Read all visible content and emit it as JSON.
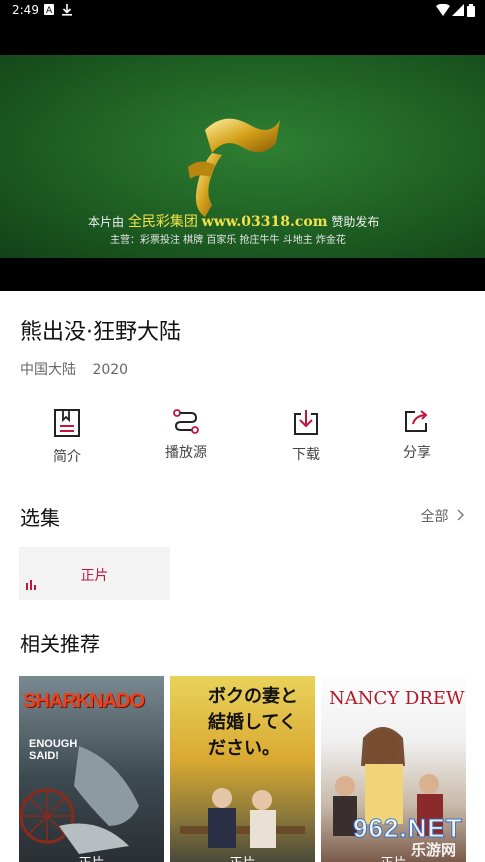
{
  "status_bar": {
    "time": "2:49"
  },
  "video": {
    "sponsor_prefix": "本片由",
    "sponsor_name": "全民彩集团",
    "sponsor_url": "www.03318.com",
    "sponsor_suffix": "赞助发布",
    "sponsor_line2": "主营：彩票投注  棋牌  百家乐  抢庄牛牛  斗地主  炸金花"
  },
  "title": "熊出没·狂野大陆",
  "meta": {
    "region": "中国大陆",
    "year": "2020"
  },
  "actions": [
    {
      "label": "简介",
      "icon": "document-icon"
    },
    {
      "label": "播放源",
      "icon": "route-icon"
    },
    {
      "label": "下载",
      "icon": "download-icon"
    },
    {
      "label": "分享",
      "icon": "share-icon"
    }
  ],
  "episodes": {
    "heading": "选集",
    "all_label": "全部",
    "items": [
      {
        "label": "正片"
      }
    ]
  },
  "recommend": {
    "heading": "相关推荐",
    "items": [
      {
        "poster_title": "SHARKNADO",
        "poster_tagline": "ENOUGH SAID!",
        "caption": "正片"
      },
      {
        "poster_title": "ボクの妻と結婚してください。",
        "caption": "正片"
      },
      {
        "poster_title": "NANCY DREW",
        "caption": "正片"
      }
    ]
  },
  "watermark": {
    "brand": "962.NET",
    "sub": "乐游网"
  },
  "colors": {
    "accent": "#c0163c",
    "video_green": "#1e5f23"
  }
}
